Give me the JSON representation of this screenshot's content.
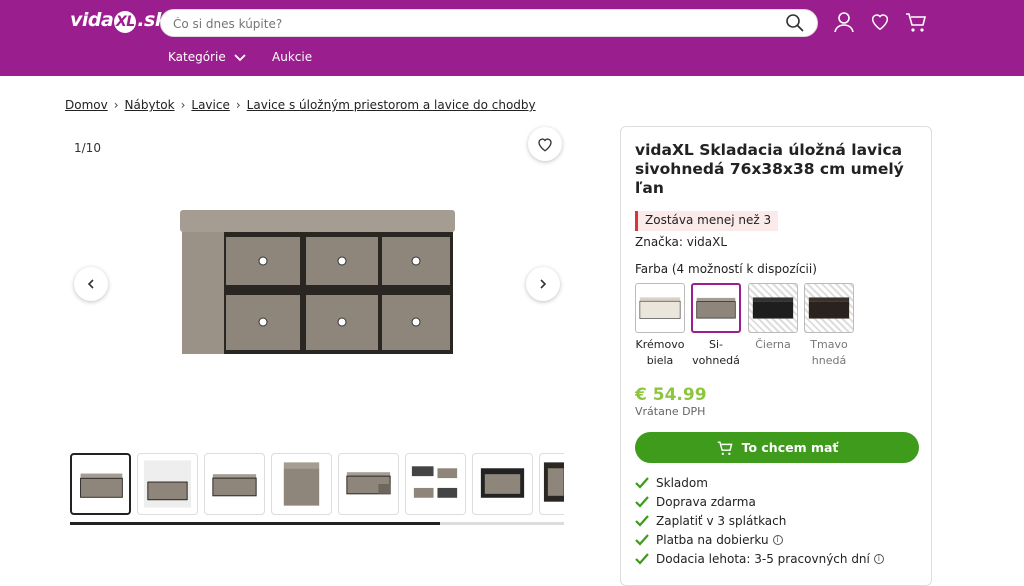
{
  "header": {
    "logo": "vidaXL.sk",
    "search_placeholder": "Čo si dnes kúpite?",
    "nav": [
      "Kategórie",
      "Aukcie"
    ],
    "icons": [
      "user-icon",
      "heart-icon",
      "cart-icon"
    ]
  },
  "breadcrumb": [
    "Domov",
    "Nábytok",
    "Lavice",
    "Lavice s úložným priestorom a lavice do chodby"
  ],
  "gallery": {
    "counter": "1/10"
  },
  "product": {
    "title": "vidaXL Skladacia úložná lavica sivohnedá 76x38x38 cm umelý ľan",
    "stock": "Zostáva menej než 3",
    "brand": "Značka: vidaXL",
    "color_label": "Farba (4 možností k dispozícii)",
    "colors": [
      {
        "line1": "Krémovo",
        "line2": "biela"
      },
      {
        "line1": "Si-",
        "line2": "vohnedá"
      },
      {
        "line1": "Čierna",
        "line2": ""
      },
      {
        "line1": "Tmavo",
        "line2": "hnedá"
      }
    ],
    "price": "€ 54.99",
    "vat": "Vrátane DPH",
    "buy_label": "To chcem mať",
    "features": [
      "Skladom",
      "Doprava zdarma",
      "Zaplatiť v 3 splátkach",
      "Platba na dobierku",
      "Dodacia lehota: 3-5 pracovných dní"
    ]
  },
  "colors": {
    "brand": "#9b1e8e",
    "buy": "#3e9b1c",
    "price": "#8cc63f"
  }
}
